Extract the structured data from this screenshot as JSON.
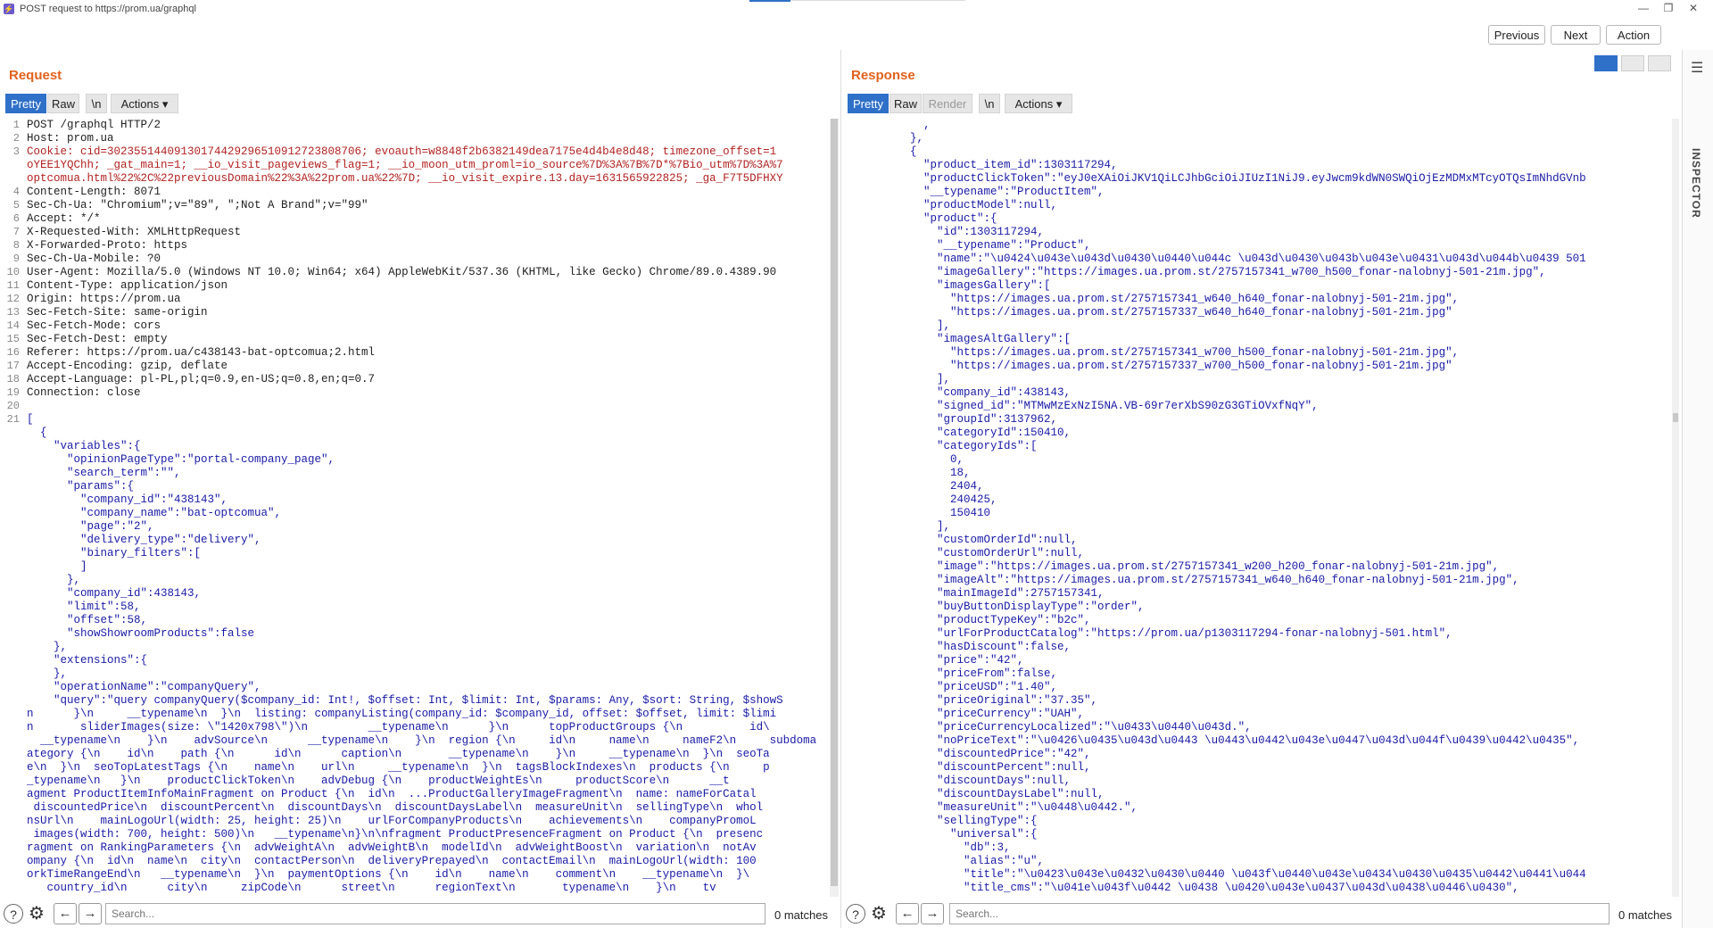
{
  "window": {
    "title": "POST request to https://prom.ua/graphql",
    "minimize": "—",
    "restore": "❐",
    "close": "✕"
  },
  "top_buttons": {
    "previous": "Previous",
    "next": "Next",
    "action": "Action"
  },
  "request": {
    "title": "Request",
    "tabs": {
      "pretty": "Pretty",
      "raw": "Raw",
      "newline": "\\n",
      "actions": "Actions ▾"
    },
    "lines": [
      {
        "n": "1",
        "t": "POST /graphql HTTP/2"
      },
      {
        "n": "2",
        "t": "Host: prom.ua"
      },
      {
        "n": "3",
        "t": "Cookie: cid=30235514409130174429296510912723808706; evoauth=w8848f2b6382149dea7175e4d4b4e8d48; timezone_offset=1"
      },
      {
        "n": "",
        "t": "oYEE1YQChh; _gat_main=1; __io_visit_pageviews_flag=1; __io_moon_utm_proml=io_source%7D%3A%7B%7D*%7Bio_utm%7D%3A%7"
      },
      {
        "n": "",
        "t": "optcomua.html%22%2C%22previousDomain%22%3A%22prom.ua%22%7D; __io_visit_expire.13.day=1631565922825; _ga_F7T5DFHXY"
      },
      {
        "n": "4",
        "t": "Content-Length: 8071"
      },
      {
        "n": "5",
        "t": "Sec-Ch-Ua: \"Chromium\";v=\"89\", \";Not A Brand\";v=\"99\""
      },
      {
        "n": "6",
        "t": "Accept: */*"
      },
      {
        "n": "7",
        "t": "X-Requested-With: XMLHttpRequest"
      },
      {
        "n": "8",
        "t": "X-Forwarded-Proto: https"
      },
      {
        "n": "9",
        "t": "Sec-Ch-Ua-Mobile: ?0"
      },
      {
        "n": "10",
        "t": "User-Agent: Mozilla/5.0 (Windows NT 10.0; Win64; x64) AppleWebKit/537.36 (KHTML, like Gecko) Chrome/89.0.4389.90"
      },
      {
        "n": "11",
        "t": "Content-Type: application/json"
      },
      {
        "n": "12",
        "t": "Origin: https://prom.ua"
      },
      {
        "n": "13",
        "t": "Sec-Fetch-Site: same-origin"
      },
      {
        "n": "14",
        "t": "Sec-Fetch-Mode: cors"
      },
      {
        "n": "15",
        "t": "Sec-Fetch-Dest: empty"
      },
      {
        "n": "16",
        "t": "Referer: https://prom.ua/c438143-bat-optcomua;2.html"
      },
      {
        "n": "17",
        "t": "Accept-Encoding: gzip, deflate"
      },
      {
        "n": "18",
        "t": "Accept-Language: pl-PL,pl;q=0.9,en-US;q=0.8,en;q=0.7"
      },
      {
        "n": "19",
        "t": "Connection: close"
      },
      {
        "n": "20",
        "t": ""
      },
      {
        "n": "21",
        "t": "["
      },
      {
        "n": "",
        "t": "  {"
      },
      {
        "n": "",
        "t": "    \"variables\":{"
      },
      {
        "n": "",
        "t": "      \"opinionPageType\":\"portal-company_page\","
      },
      {
        "n": "",
        "t": "      \"search_term\":\"\","
      },
      {
        "n": "",
        "t": "      \"params\":{"
      },
      {
        "n": "",
        "t": "        \"company_id\":\"438143\","
      },
      {
        "n": "",
        "t": "        \"company_name\":\"bat-optcomua\","
      },
      {
        "n": "",
        "t": "        \"page\":\"2\","
      },
      {
        "n": "",
        "t": "        \"delivery_type\":\"delivery\","
      },
      {
        "n": "",
        "t": "        \"binary_filters\":["
      },
      {
        "n": "",
        "t": "        ]"
      },
      {
        "n": "",
        "t": "      },"
      },
      {
        "n": "",
        "t": "      \"company_id\":438143,"
      },
      {
        "n": "",
        "t": "      \"limit\":58,"
      },
      {
        "n": "",
        "t": "      \"offset\":58,"
      },
      {
        "n": "",
        "t": "      \"showShowroomProducts\":false"
      },
      {
        "n": "",
        "t": "    },"
      },
      {
        "n": "",
        "t": "    \"extensions\":{"
      },
      {
        "n": "",
        "t": "    },"
      },
      {
        "n": "",
        "t": "    \"operationName\":\"companyQuery\","
      },
      {
        "n": "",
        "t": "    \"query\":\"query companyQuery($company_id: Int!, $offset: Int, $limit: Int, $params: Any, $sort: String, $showS"
      },
      {
        "n": "",
        "t": "n      }\\n     __typename\\n  }\\n  listing: companyListing(company_id: $company_id, offset: $offset, limit: $limi"
      },
      {
        "n": "",
        "t": "n       sliderImages(size: \\\"1420x798\\\")\\n         __typename\\n      }\\n      topProductGroups {\\n          id\\"
      },
      {
        "n": "",
        "t": "  __typename\\n    }\\n    advSource\\n      __typename\\n    }\\n  region {\\n     id\\n     name\\n     nameF2\\n     subdoma"
      },
      {
        "n": "",
        "t": "ategory {\\n    id\\n    path {\\n      id\\n      caption\\n       __typename\\n    }\\n     __typename\\n  }\\n  seoTa"
      },
      {
        "n": "",
        "t": "e\\n  }\\n  seoTopLatestTags {\\n    name\\n    url\\n     __typename\\n  }\\n  tagsBlockIndexes\\n  products {\\n     p"
      },
      {
        "n": "",
        "t": "_typename\\n   }\\n    productClickToken\\n    advDebug {\\n    productWeightEs\\n     productScore\\n      __t"
      },
      {
        "n": "",
        "t": "agment ProductItemInfoMainFragment on Product {\\n  id\\n  ...ProductGalleryImageFragment\\n  name: nameForCatal"
      },
      {
        "n": "",
        "t": " discountedPrice\\n  discountPercent\\n  discountDays\\n  discountDaysLabel\\n  measureUnit\\n  sellingType\\n  whol"
      },
      {
        "n": "",
        "t": "nsUrl\\n    mainLogoUrl(width: 25, height: 25)\\n    urlForCompanyProducts\\n    achievements\\n    companyPromoL"
      },
      {
        "n": "",
        "t": " images(width: 700, height: 500)\\n   __typename\\n}\\n\\nfragment ProductPresenceFragment on Product {\\n  presenc"
      },
      {
        "n": "",
        "t": "ragment on RankingParameters {\\n  advWeightA\\n  advWeightB\\n  modelId\\n  advWeightBoost\\n  variation\\n  notAv"
      },
      {
        "n": "",
        "t": "ompany {\\n  id\\n  name\\n  city\\n  contactPerson\\n  deliveryPrepayed\\n  contactEmail\\n  mainLogoUrl(width: 100"
      },
      {
        "n": "",
        "t": "orkTimeRangeEnd\\n   __typename\\n  }\\n  paymentOptions {\\n    id\\n    name\\n    comment\\n    __typename\\n  }\\"
      },
      {
        "n": "",
        "t": "   country_id\\n      city\\n     zipCode\\n      street\\n      regionText\\n       typename\\n    }\\n    tv"
      }
    ],
    "search_placeholder": "Search...",
    "matches": "0 matches"
  },
  "response": {
    "title": "Response",
    "tabs": {
      "pretty": "Pretty",
      "raw": "Raw",
      "render": "Render",
      "newline": "\\n",
      "actions": "Actions ▾"
    },
    "lines": [
      "          ,",
      "        },",
      "        {",
      "          \"product_item_id\":1303117294,",
      "          \"productClickToken\":\"eyJ0eXAiOiJKV1QiLCJhbGciOiJIUzI1NiJ9.eyJwcm9kdWN0SWQiOjEzMDMxMTcyOTQsImNhdGVnb",
      "          \"__typename\":\"ProductItem\",",
      "          \"productModel\":null,",
      "          \"product\":{",
      "            \"id\":1303117294,",
      "            \"__typename\":\"Product\",",
      "            \"name\":\"\\u0424\\u043e\\u043d\\u0430\\u0440\\u044c \\u043d\\u0430\\u043b\\u043e\\u0431\\u043d\\u044b\\u0439 501",
      "            \"imageGallery\":\"https://images.ua.prom.st/2757157341_w700_h500_fonar-nalobnyj-501-21m.jpg\",",
      "            \"imagesGallery\":[",
      "              \"https://images.ua.prom.st/2757157341_w640_h640_fonar-nalobnyj-501-21m.jpg\",",
      "              \"https://images.ua.prom.st/2757157337_w640_h640_fonar-nalobnyj-501-21m.jpg\"",
      "            ],",
      "            \"imagesAltGallery\":[",
      "              \"https://images.ua.prom.st/2757157341_w700_h500_fonar-nalobnyj-501-21m.jpg\",",
      "              \"https://images.ua.prom.st/2757157337_w700_h500_fonar-nalobnyj-501-21m.jpg\"",
      "            ],",
      "            \"company_id\":438143,",
      "            \"signed_id\":\"MTMwMzExNzI5NA.VB-69r7erXbS90zG3GTiOVxfNqY\",",
      "            \"groupId\":3137962,",
      "            \"categoryId\":150410,",
      "            \"categoryIds\":[",
      "              0,",
      "              18,",
      "              2404,",
      "              240425,",
      "              150410",
      "            ],",
      "            \"customOrderId\":null,",
      "            \"customOrderUrl\":null,",
      "            \"image\":\"https://images.ua.prom.st/2757157341_w200_h200_fonar-nalobnyj-501-21m.jpg\",",
      "            \"imageAlt\":\"https://images.ua.prom.st/2757157341_w640_h640_fonar-nalobnyj-501-21m.jpg\",",
      "            \"mainImageId\":2757157341,",
      "            \"buyButtonDisplayType\":\"order\",",
      "            \"productTypeKey\":\"b2c\",",
      "            \"urlForProductCatalog\":\"https://prom.ua/p1303117294-fonar-nalobnyj-501.html\",",
      "            \"hasDiscount\":false,",
      "            \"price\":\"42\",",
      "            \"priceFrom\":false,",
      "            \"priceUSD\":\"1.40\",",
      "            \"priceOriginal\":\"37.35\",",
      "            \"priceCurrency\":\"UAH\",",
      "            \"priceCurrencyLocalized\":\"\\u0433\\u0440\\u043d.\",",
      "            \"noPriceText\":\"\\u0426\\u0435\\u043d\\u0443 \\u0443\\u0442\\u043e\\u0447\\u043d\\u044f\\u0439\\u0442\\u0435\",",
      "            \"discountedPrice\":\"42\",",
      "            \"discountPercent\":null,",
      "            \"discountDays\":null,",
      "            \"discountDaysLabel\":null,",
      "            \"measureUnit\":\"\\u0448\\u0442.\",",
      "            \"sellingType\":{",
      "              \"universal\":{",
      "                \"db\":3,",
      "                \"alias\":\"u\",",
      "                \"title\":\"\\u0423\\u043e\\u0432\\u0430\\u0440 \\u043f\\u0440\\u043e\\u0434\\u0430\\u0435\\u0442\\u0441\\u044",
      "                \"title_cms\":\"\\u041e\\u043f\\u0442 \\u0438 \\u0420\\u043e\\u0437\\u043d\\u0438\\u0446\\u0430\","
    ],
    "search_placeholder": "Search...",
    "matches": "0 matches"
  },
  "inspector": {
    "label": "INSPECTOR"
  },
  "icons": {
    "help": "?",
    "settings": "⚙",
    "back": "←",
    "forward": "→",
    "menu": "☰"
  }
}
